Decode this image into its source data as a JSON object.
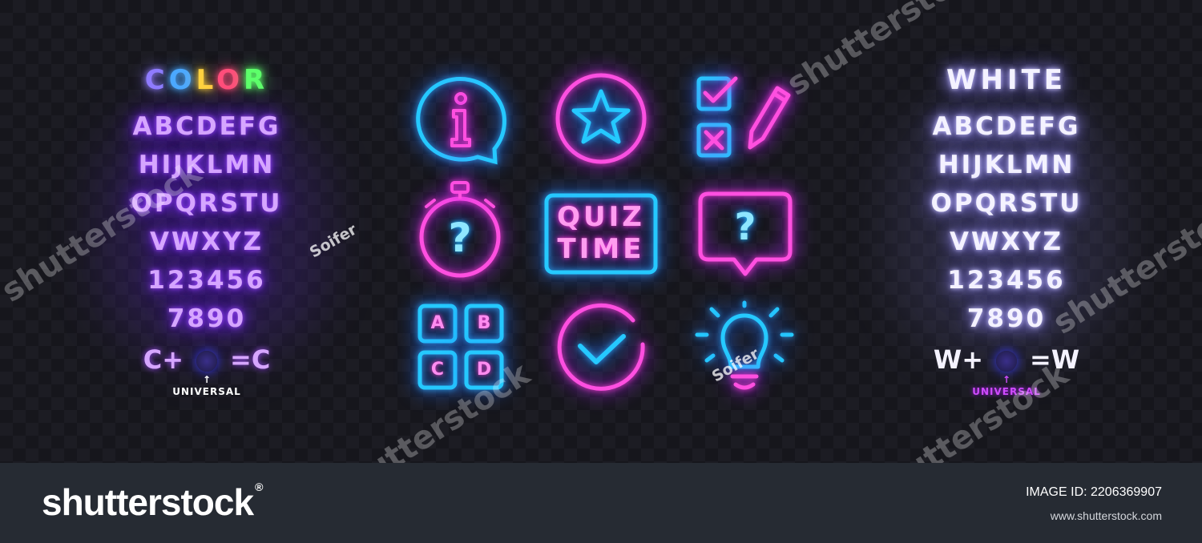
{
  "color_panel": {
    "title_letters": [
      {
        "char": "C",
        "color": "#8f7bff"
      },
      {
        "char": "O",
        "color": "#4ba8ff"
      },
      {
        "char": "L",
        "color": "#ffd23f"
      },
      {
        "char": "O",
        "color": "#ff4d7a"
      },
      {
        "char": "R",
        "color": "#5dff6a"
      }
    ],
    "rows": [
      "ABCDEFG",
      "HIJKLMN",
      "OPQRSTU",
      "VWXYZ",
      "123456",
      "7890"
    ],
    "formula_left": "C+",
    "formula_right": "=C",
    "formula_arrow": "↑",
    "universal_label": "UNIVERSAL",
    "universal_color": "#ffffff"
  },
  "white_panel": {
    "title": "WHITE",
    "rows": [
      "ABCDEFG",
      "HIJKLMN",
      "OPQRSTU",
      "VWXYZ",
      "123456",
      "7890"
    ],
    "formula_left": "W+",
    "formula_right": "=W",
    "formula_arrow": "↑",
    "universal_label": "UNIVERSAL",
    "universal_color": "#d04bff"
  },
  "icons": {
    "info_glyph": "i",
    "quiz_line1": "QUIZ",
    "quiz_line2": "TIME",
    "timer_glyph": "?",
    "bubble_glyph": "?",
    "abcd": [
      "A",
      "B",
      "C",
      "D"
    ]
  },
  "watermarks": {
    "big": "shutterstock",
    "author": "Soifer"
  },
  "footer": {
    "logo": "shutterstock",
    "logo_mark": "®",
    "image_id": "IMAGE ID: 2206369907",
    "site": "www.shutterstock.com"
  },
  "colors": {
    "neon_blue": "#25c9ff",
    "neon_pink": "#ff4fe0",
    "footer_bg": "#262b33"
  }
}
